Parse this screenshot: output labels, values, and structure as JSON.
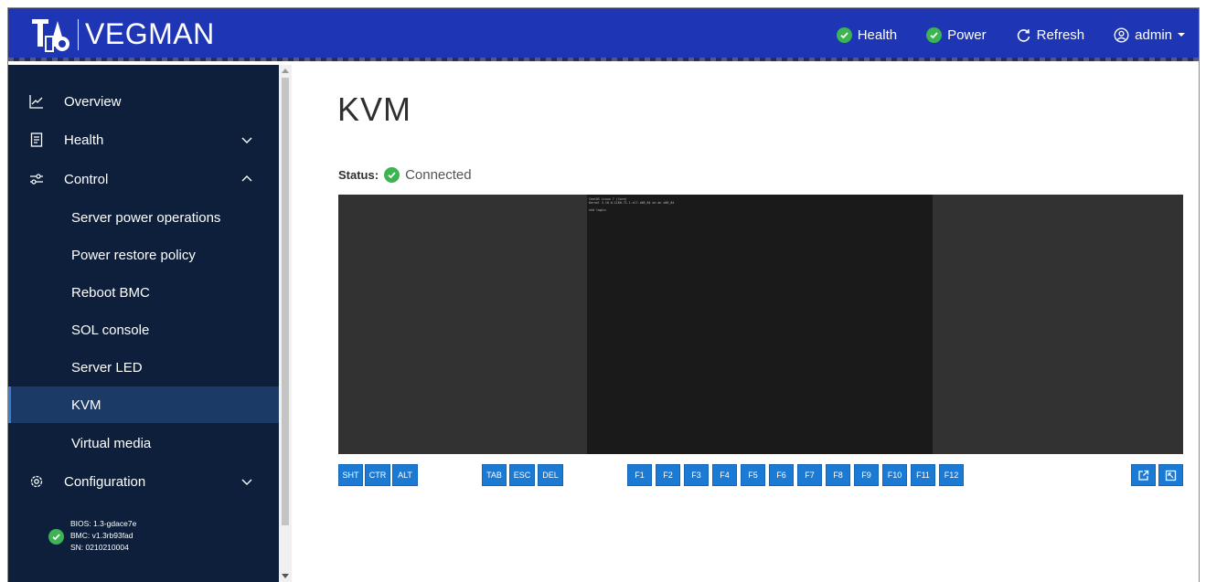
{
  "header": {
    "brand": "VEGMAN",
    "actions": [
      {
        "label": "Health",
        "icon": "check-circle-icon"
      },
      {
        "label": "Power",
        "icon": "check-circle-icon"
      },
      {
        "label": "Refresh",
        "icon": "refresh-icon"
      },
      {
        "label": "admin",
        "icon": "user-circle-icon"
      }
    ]
  },
  "sidebar": {
    "items": [
      {
        "label": "Overview",
        "icon": "chart-line-icon"
      },
      {
        "label": "Health",
        "icon": "clipboard-icon",
        "expanded": false
      },
      {
        "label": "Control",
        "icon": "sliders-icon",
        "expanded": true
      },
      {
        "label": "Configuration",
        "icon": "gear-icon",
        "expanded": false
      }
    ],
    "control_sub": [
      {
        "label": "Server power operations"
      },
      {
        "label": "Power restore policy"
      },
      {
        "label": "Reboot BMC"
      },
      {
        "label": "SOL console"
      },
      {
        "label": "Server LED"
      },
      {
        "label": "KVM",
        "active": true
      },
      {
        "label": "Virtual media"
      }
    ],
    "footer": {
      "bios": "BIOS: 1.3-gdace7e",
      "bmc": "BMC: v1.3rb93fad",
      "sn": "SN: 0210210004"
    }
  },
  "main": {
    "title": "KVM",
    "status_label": "Status:",
    "status_value": "Connected",
    "terminal": {
      "line1": "CentOS Linux 7 (Core)",
      "line2": "Kernel 3.10.0-1160.71.1.el7.x86_64 on an x86_64",
      "line3": "vhd login:"
    },
    "keys": {
      "mod": [
        "SHT",
        "CTR",
        "ALT"
      ],
      "nav": [
        "TAB",
        "ESC",
        "DEL"
      ],
      "fn": [
        "F1",
        "F2",
        "F3",
        "F4",
        "F5",
        "F6",
        "F7",
        "F8",
        "F9",
        "F10",
        "F11",
        "F12"
      ]
    }
  },
  "colors": {
    "header_bg": "#1e35b4",
    "sidebar_bg": "#0d1f3a",
    "active_bg": "#1b3a66",
    "accent_blue": "#1a7ad4",
    "success_green": "#3cb451"
  }
}
